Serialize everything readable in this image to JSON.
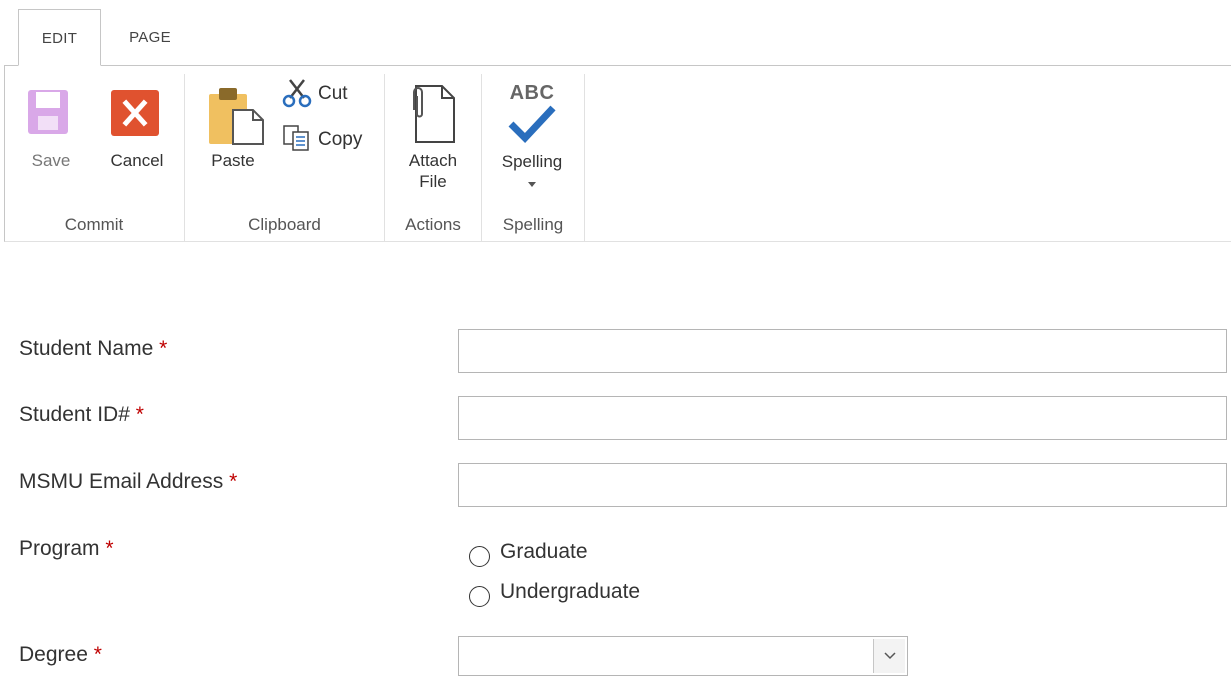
{
  "tabs": [
    {
      "label": "EDIT",
      "active": true
    },
    {
      "label": "PAGE",
      "active": false
    }
  ],
  "ribbon": {
    "commit": {
      "label": "Commit",
      "save": "Save",
      "cancel": "Cancel"
    },
    "clipboard": {
      "label": "Clipboard",
      "paste": "Paste",
      "cut": "Cut",
      "copy": "Copy"
    },
    "actions": {
      "label": "Actions",
      "attach_line1": "Attach",
      "attach_line2": "File"
    },
    "spelling": {
      "label": "Spelling",
      "button": "Spelling",
      "icon_text": "ABC"
    }
  },
  "form": {
    "required_marker": "*",
    "student_name": {
      "label": "Student Name",
      "value": ""
    },
    "student_id": {
      "label": "Student ID#",
      "value": ""
    },
    "email": {
      "label": "MSMU Email Address",
      "value": ""
    },
    "program": {
      "label": "Program",
      "options": [
        "Graduate",
        "Undergraduate"
      ],
      "selected": null
    },
    "degree": {
      "label": "Degree",
      "value": ""
    }
  },
  "colors": {
    "required": "#bf0000",
    "cancel_icon": "#e0522f",
    "save_icon_disabled": "#d9a8e8",
    "paste_clipboard": "#f0c060",
    "spelling_check": "#2a6ebd"
  }
}
